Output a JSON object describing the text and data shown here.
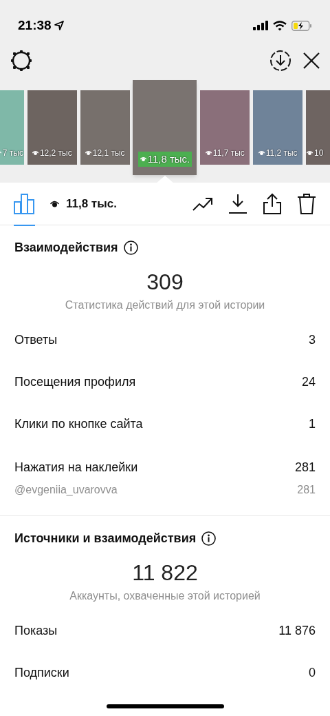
{
  "status_bar": {
    "time": "21:38"
  },
  "thumbnails": [
    {
      "views": "7 тыс",
      "selected": false
    },
    {
      "views": "12,2 тыс",
      "selected": false
    },
    {
      "views": "12,1 тыс",
      "selected": false
    },
    {
      "views": "11,8 тыс.",
      "selected": true
    },
    {
      "views": "11,7 тыс",
      "selected": false
    },
    {
      "views": "11,2 тыс",
      "selected": false
    },
    {
      "views": "10",
      "selected": false
    }
  ],
  "toolbar": {
    "stats_tab": {
      "selected": true
    },
    "views": "11,8 тыс."
  },
  "sections": [
    {
      "title": "Взаимодействия",
      "total": "309",
      "caption": "Статистика действий для этой истории",
      "rows": [
        {
          "label": "Ответы",
          "value": "3"
        },
        {
          "label": "Посещения профиля",
          "value": "24"
        },
        {
          "label": "Клики по кнопке сайта",
          "value": "1"
        },
        {
          "label": "Нажатия на наклейки",
          "value": "281",
          "sub": [
            {
              "label": "@evgeniia_uvarovva",
              "value": "281"
            }
          ]
        }
      ]
    },
    {
      "title": "Источники и взаимодействия",
      "total": "11 822",
      "caption": "Аккаунты, охваченные этой историей",
      "rows": [
        {
          "label": "Показы",
          "value": "11 876"
        },
        {
          "label": "Подписки",
          "value": "0"
        }
      ]
    }
  ]
}
